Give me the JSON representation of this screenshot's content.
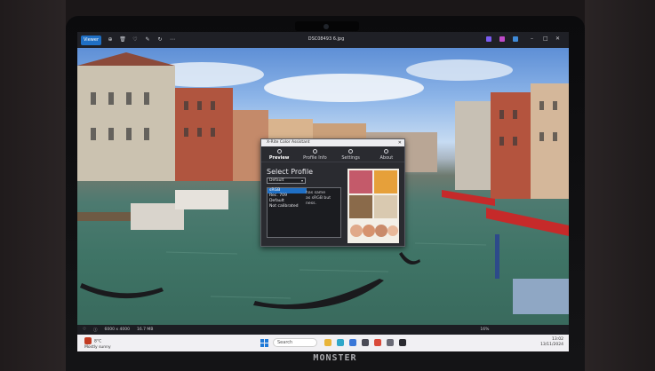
{
  "app": {
    "view_label": "Viewer",
    "file_name": "DSC08493 6.jpg",
    "toolbar_icons": [
      "zoom-icon",
      "delete-icon",
      "favorite-icon",
      "edit-icon",
      "rotate-icon",
      "more-icon"
    ],
    "window_controls": [
      "–",
      "□",
      "✕"
    ]
  },
  "status": {
    "dimensions": "6000 x 4000",
    "size": "16.7 MB",
    "zoom": "16%"
  },
  "dialog": {
    "title": "X-Rite Color Assistant",
    "tabs": [
      {
        "label": "Preview",
        "icon": "preview-icon"
      },
      {
        "label": "Profile Info",
        "icon": "info-icon"
      },
      {
        "label": "Settings",
        "icon": "settings-icon"
      },
      {
        "label": "About",
        "icon": "about-icon"
      }
    ],
    "heading": "Select Profile",
    "dropdown_value": "Default",
    "profiles": [
      "sRGB",
      "Rec. 709",
      "Default",
      "Not calibrated"
    ],
    "selected_profile": "sRGB",
    "description": [
      "has same",
      "as sRGB but",
      "ness."
    ]
  },
  "taskbar": {
    "weather_temp": "8°C",
    "weather_text": "Mostly sunny",
    "search_placeholder": "Search",
    "time": "13:02",
    "date": "13/11/2024"
  },
  "bezel": {
    "brand": "MONSTER"
  },
  "colors": {
    "accent": "#1f6fc4",
    "water": "#3f7466",
    "sky": "#8db5e8"
  }
}
